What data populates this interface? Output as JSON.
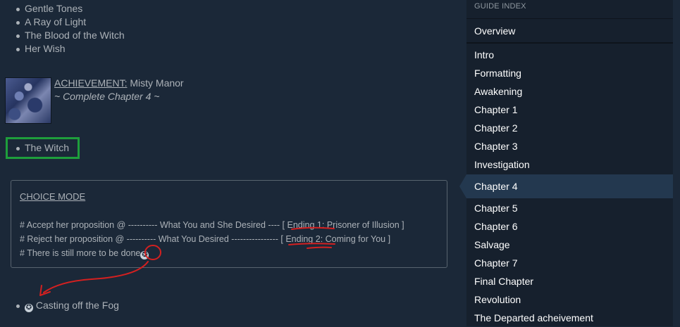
{
  "top_list": [
    "Gentle Tones",
    "A Ray of Light",
    "The Blood of the Witch",
    "Her Wish"
  ],
  "achievement": {
    "label": "ACHIEVEMENT:",
    "name": "Misty Manor",
    "subtitle": "~ Complete Chapter 4 ~"
  },
  "witch_item": "The Witch",
  "choice": {
    "title": "CHOICE MODE",
    "line1": {
      "text": "# Accept her proposition @ ---------- What You and She Desired ---- [",
      "ending": "Ending 1",
      "rest": ": Prisoner of Illusion ]"
    },
    "line2": {
      "text": "# Reject her proposition @ ---------- What You Desired ---------------- [",
      "ending": "Ending 2",
      "rest": ": Coming for You ]"
    },
    "line3": {
      "text": "# There is still more to be done",
      "star": "✪"
    }
  },
  "bottom_item": {
    "star": "✪",
    "label": "Casting off the Fog"
  },
  "sidebar": {
    "header": "GUIDE INDEX",
    "items": [
      "Overview",
      "Intro",
      "Formatting",
      "Awakening",
      "Chapter 1",
      "Chapter 2",
      "Chapter 3",
      "Investigation",
      "Chapter 4",
      "Chapter 5",
      "Chapter 6",
      "Salvage",
      "Chapter 7",
      "Final Chapter",
      "Revolution",
      "The Departed acheivement"
    ],
    "active": "Chapter 4"
  },
  "colors": {
    "background": "#1b2838",
    "sidebar": "#16202d",
    "active": "#23384f",
    "highlight_box": "#1e9e3c",
    "annotation": "#d42020"
  }
}
